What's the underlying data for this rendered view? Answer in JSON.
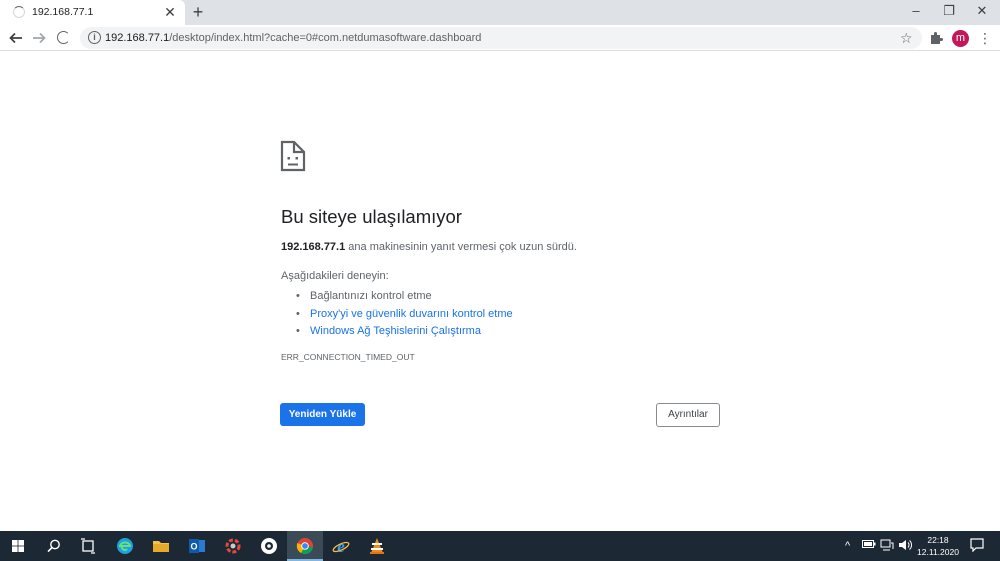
{
  "browser": {
    "tab": {
      "title": "192.168.77.1",
      "close_glyph": "✕"
    },
    "new_tab_glyph": "+",
    "window_controls": {
      "minimize": "–",
      "restore": "❐",
      "close": "✕"
    },
    "url": {
      "host": "192.168.77.1",
      "path": "/desktop/index.html?cache=0#com.netdumasoftware.dashboard"
    },
    "profile_initial": "m",
    "profile_color": "#c2185b"
  },
  "error_page": {
    "title": "Bu siteye ulaşılamıyor",
    "host": "192.168.77.1",
    "description": " ana makinesinin yanıt vermesi çok uzun sürdü.",
    "try_label": "Aşağıdakileri deneyin:",
    "suggestions": [
      {
        "text": "Bağlantınızı kontrol etme",
        "link": false
      },
      {
        "text": "Proxy'yi ve güvenlik duvarını kontrol etme",
        "link": true
      },
      {
        "text": "Windows Ağ Teşhislerini Çalıştırma",
        "link": true
      }
    ],
    "error_code": "ERR_CONNECTION_TIMED_OUT",
    "reload_label": "Yeniden Yükle",
    "details_label": "Ayrıntılar",
    "accent_color": "#1a73e8"
  },
  "taskbar": {
    "apps": [
      "start-icon",
      "search-icon",
      "task-view-icon",
      "edge-icon",
      "file-explorer-icon",
      "outlook-icon",
      "app-icon",
      "settings-app-icon",
      "chrome-icon",
      "internet-explorer-icon",
      "vlc-icon"
    ],
    "active_app": "chrome-icon",
    "clock": {
      "time": "22:18",
      "date": "12.11.2020"
    }
  }
}
